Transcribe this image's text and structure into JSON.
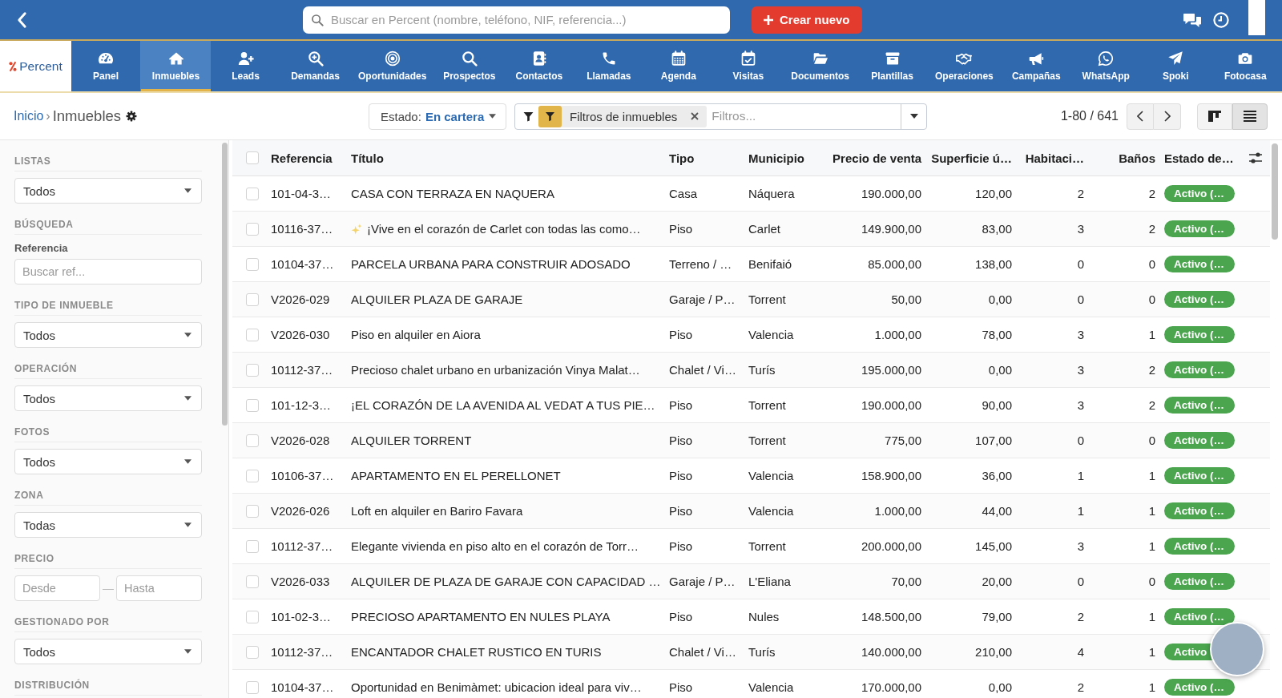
{
  "top_bar": {
    "search": {
      "placeholder": "Buscar en Percent (nombre, teléfono, NIF, referencia...)"
    },
    "create_button": {
      "label": "Crear nuevo"
    }
  },
  "nav": {
    "logo": "Percent",
    "items": [
      {
        "label": "Panel",
        "selected": false
      },
      {
        "label": "Inmuebles",
        "selected": true
      },
      {
        "label": "Leads",
        "selected": false
      },
      {
        "label": "Demandas",
        "selected": false
      },
      {
        "label": "Oportunidades",
        "selected": false
      },
      {
        "label": "Prospectos",
        "selected": false
      },
      {
        "label": "Contactos",
        "selected": false
      },
      {
        "label": "Llamadas",
        "selected": false
      },
      {
        "label": "Agenda",
        "selected": false
      },
      {
        "label": "Visitas",
        "selected": false
      },
      {
        "label": "Documentos",
        "selected": false
      },
      {
        "label": "Plantillas",
        "selected": false
      },
      {
        "label": "Operaciones",
        "selected": false
      },
      {
        "label": "Campañas",
        "selected": false
      },
      {
        "label": "WhatsApp",
        "selected": false
      },
      {
        "label": "Spoki",
        "selected": false
      },
      {
        "label": "Fotocasa",
        "selected": false
      }
    ]
  },
  "toolbar": {
    "breadcrumb": {
      "link": "Inicio",
      "separator": "›",
      "current": "Inmuebles"
    },
    "status_dropdown": {
      "label": "Estado:",
      "value": "En cartera"
    },
    "filter": {
      "chip": "Filtros de inmuebles",
      "placeholder": "Filtros..."
    },
    "pagination": "1-80 / 641",
    "views": [
      {
        "kind": "board",
        "selected": false
      },
      {
        "kind": "list",
        "selected": true
      }
    ]
  },
  "sidebar": {
    "sections": [
      {
        "title": "LISTAS",
        "fields": [
          {
            "kind": "select",
            "value": "Todos"
          }
        ]
      },
      {
        "title": "BÚSQUEDA",
        "fields": [
          {
            "kind": "text",
            "label": "Referencia",
            "placeholder": "Buscar ref..."
          }
        ]
      },
      {
        "title": "TIPO DE INMUEBLE",
        "fields": [
          {
            "kind": "select",
            "value": "Todos"
          }
        ]
      },
      {
        "title": "OPERACIÓN",
        "fields": [
          {
            "kind": "select",
            "value": "Todos"
          }
        ]
      },
      {
        "title": "FOTOS",
        "fields": [
          {
            "kind": "select",
            "value": "Todos"
          }
        ]
      },
      {
        "title": "ZONA",
        "fields": [
          {
            "kind": "select",
            "value": "Todas"
          }
        ]
      },
      {
        "title": "PRECIO",
        "fields": [
          {
            "kind": "range",
            "from_placeholder": "Desde",
            "separator": "—",
            "to_placeholder": "Hasta"
          }
        ]
      },
      {
        "title": "GESTIONADO POR",
        "fields": [
          {
            "kind": "select",
            "value": "Todos"
          }
        ]
      },
      {
        "title": "DISTRIBUCIÓN"
      }
    ]
  },
  "table": {
    "all_checked": false,
    "columns": [
      {
        "label": "Referencia",
        "kind": "text"
      },
      {
        "label": "Título",
        "kind": "title"
      },
      {
        "label": "Tipo",
        "kind": "text"
      },
      {
        "label": "Municipio",
        "kind": "text"
      },
      {
        "label": "Precio de venta",
        "kind": "number"
      },
      {
        "label": "Superficie ú…",
        "kind": "number"
      },
      {
        "label": "Habitaci…",
        "kind": "number"
      },
      {
        "label": "Baños",
        "kind": "number"
      },
      {
        "label": "Estado de…",
        "kind": "badge"
      }
    ],
    "rows": [
      {
        "checked": false,
        "cells": [
          "101-04-3…",
          "CASA CON TERRAZA EN NAQUERA",
          "Casa",
          "Náquera",
          "190.000,00",
          "120,00",
          "2",
          "2"
        ],
        "status": "Activo (…"
      },
      {
        "checked": false,
        "sparkle": true,
        "cells": [
          "10116-37…",
          "¡Vive en el corazón de Carlet con todas las como…",
          "Piso",
          "Carlet",
          "149.900,00",
          "83,00",
          "3",
          "2"
        ],
        "status": "Activo (…"
      },
      {
        "checked": false,
        "cells": [
          "10104-37…",
          "PARCELA URBANA PARA CONSTRUIR ADOSADO",
          "Terreno / …",
          "Benifaió",
          "85.000,00",
          "138,00",
          "0",
          "0"
        ],
        "status": "Activo (…"
      },
      {
        "checked": false,
        "cells": [
          "V2026-029",
          "ALQUILER PLAZA DE GARAJE",
          "Garaje / P…",
          "Torrent",
          "50,00",
          "0,00",
          "0",
          "0"
        ],
        "status": "Activo (…"
      },
      {
        "checked": false,
        "cells": [
          "V2026-030",
          "Piso en alquiler en Aiora",
          "Piso",
          "Valencia",
          "1.000,00",
          "78,00",
          "3",
          "1"
        ],
        "status": "Activo (…"
      },
      {
        "checked": false,
        "cells": [
          "10112-37…",
          "Precioso chalet urbano en urbanización Vinya Malat…",
          "Chalet / Vi…",
          "Turís",
          "195.000,00",
          "0,00",
          "3",
          "2"
        ],
        "status": "Activo (…"
      },
      {
        "checked": false,
        "cells": [
          "101-12-3…",
          "¡EL CORAZÓN DE LA AVENIDA AL VEDAT A TUS PIE…",
          "Piso",
          "Torrent",
          "190.000,00",
          "90,00",
          "3",
          "2"
        ],
        "status": "Activo (…"
      },
      {
        "checked": false,
        "cells": [
          "V2026-028",
          "ALQUILER TORRENT",
          "Piso",
          "Torrent",
          "775,00",
          "107,00",
          "0",
          "0"
        ],
        "status": "Activo (…"
      },
      {
        "checked": false,
        "cells": [
          "10106-37…",
          "APARTAMENTO EN EL PERELLONET",
          "Piso",
          "Valencia",
          "158.900,00",
          "36,00",
          "1",
          "1"
        ],
        "status": "Activo (…"
      },
      {
        "checked": false,
        "cells": [
          "V2026-026",
          "Loft en alquiler en Bariro Favara",
          "Piso",
          "Valencia",
          "1.000,00",
          "44,00",
          "1",
          "1"
        ],
        "status": "Activo (…"
      },
      {
        "checked": false,
        "cells": [
          "10112-37…",
          "Elegante vivienda en piso alto en el corazón de Torr…",
          "Piso",
          "Torrent",
          "200.000,00",
          "145,00",
          "3",
          "1"
        ],
        "status": "Activo (…"
      },
      {
        "checked": false,
        "cells": [
          "V2026-033",
          "ALQUILER DE PLAZA DE GARAJE CON CAPACIDAD …",
          "Garaje / P…",
          "L'Eliana",
          "70,00",
          "20,00",
          "0",
          "0"
        ],
        "status": "Activo (…"
      },
      {
        "checked": false,
        "cells": [
          "101-02-3…",
          "PRECIOSO APARTAMENTO EN NULES PLAYA",
          "Piso",
          "Nules",
          "148.500,00",
          "79,00",
          "2",
          "1"
        ],
        "status": "Activo (…"
      },
      {
        "checked": false,
        "cells": [
          "10112-37…",
          "ENCANTADOR CHALET RUSTICO EN TURIS",
          "Chalet / Vi…",
          "Turís",
          "140.000,00",
          "210,00",
          "4",
          "1"
        ],
        "status": "Activo"
      },
      {
        "checked": false,
        "cells": [
          "10104-37…",
          "Oportunidad en Benimàmet: ubicacion ideal para viv…",
          "Piso",
          "Valencia",
          "170.000,00",
          "0,00",
          "2",
          "1"
        ],
        "status": "Activo (…"
      }
    ]
  }
}
